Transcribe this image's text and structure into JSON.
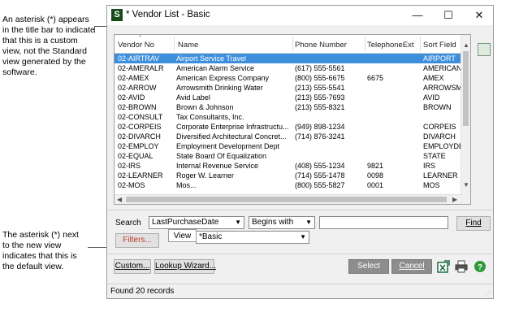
{
  "callouts": {
    "top": [
      "An asterisk (*) appears",
      "in the title bar to indicate",
      "that this is a custom",
      "view, not the Standard",
      "view generated by the",
      "software."
    ],
    "bottom": [
      "The asterisk (*) next",
      "to the new view",
      "indicates that this is",
      "the default view."
    ]
  },
  "window": {
    "icon_letter": "S",
    "title": "* Vendor List - Basic",
    "minimize": "—",
    "maximize": "☐",
    "close": "✕"
  },
  "grid": {
    "columns": [
      "Vendor No",
      "Name",
      "Phone Number",
      "TelephoneExt",
      "Sort Field"
    ],
    "rows": [
      [
        "02-AIRTRAV",
        "Airport Service Travel",
        "",
        "",
        "AIRPORT"
      ],
      [
        "02-AMERALR",
        "American Alarm Service",
        "(617) 555-5561",
        "",
        "AMERICAN"
      ],
      [
        "02-AMEX",
        "American Express Company",
        "(800) 555-6675",
        "6675",
        "AMEX"
      ],
      [
        "02-ARROW",
        "Arrowsmith Drinking Water",
        "(213) 555-5541",
        "",
        "ARROWSM"
      ],
      [
        "02-AVID",
        "Avid Label",
        "(213) 555-7693",
        "",
        "AVID"
      ],
      [
        "02-BROWN",
        "Brown & Johnson",
        "(213) 555-8321",
        "",
        "BROWN"
      ],
      [
        "02-CONSULT",
        "Tax Consultants, Inc.",
        "",
        "",
        ""
      ],
      [
        "02-CORPEIS",
        "Corporate Enterprise Infrastructu...",
        "(949) 898-1234",
        "",
        "CORPEIS"
      ],
      [
        "02-DIVARCH",
        "Diversified Architectural Concret...",
        "(714) 876-3241",
        "",
        "DIVARCH"
      ],
      [
        "02-EMPLOY",
        "Employment Development Dept",
        "",
        "",
        "EMPLOYDE"
      ],
      [
        "02-EQUAL",
        "State Board Of Equalization",
        "",
        "",
        "STATE"
      ],
      [
        "02-IRS",
        "Internal Revenue Service",
        "(408) 555-1234",
        "9821",
        "IRS"
      ],
      [
        "02-LEARNER",
        "Roger W. Learner",
        "(714) 555-1478",
        "0098",
        "LEARNER"
      ],
      [
        "02-MOS",
        "Mos...",
        "(800) 555-5827",
        "0001",
        "MOS"
      ]
    ],
    "selected_row": 0
  },
  "search": {
    "label": "Search",
    "field": "LastPurchaseDate",
    "operator": "Begins with",
    "value": "",
    "find": "Find"
  },
  "view": {
    "filters": "Filters...",
    "tooltip": "View",
    "value": "*Basic"
  },
  "buttons": {
    "custom": "Custom...",
    "lookup": "Lookup Wizard...",
    "select": "Select",
    "cancel": "Cancel"
  },
  "status": "Found 20 records",
  "colors": {
    "selected_row": "#3d8fdc",
    "filters_text": "#c0392b"
  }
}
